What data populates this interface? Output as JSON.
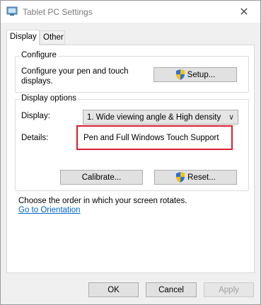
{
  "window": {
    "title": "Tablet PC Settings",
    "close_glyph": "✕"
  },
  "tabs": [
    {
      "label": "Display",
      "active": true
    },
    {
      "label": "Other",
      "active": false
    }
  ],
  "configure": {
    "group_title": "Configure",
    "description": "Configure your pen and touch displays.",
    "description_line1": "Configure your pen and touch",
    "description_line2": "displays.",
    "setup_label": "Setup..."
  },
  "display_options": {
    "group_title": "Display options",
    "display_label": "Display:",
    "display_value": "1. Wide viewing angle & High density",
    "details_label": "Details:",
    "details_value": "Pen and Full Windows Touch Support",
    "calibrate_label": "Calibrate...",
    "reset_label": "Reset..."
  },
  "rotation": {
    "text": "Choose the order in which your screen rotates.",
    "link": "Go to Orientation"
  },
  "footer": {
    "ok_label": "OK",
    "cancel_label": "Cancel",
    "apply_label": "Apply"
  },
  "colors": {
    "highlight": "#d81e2c",
    "link": "#0066cc"
  }
}
